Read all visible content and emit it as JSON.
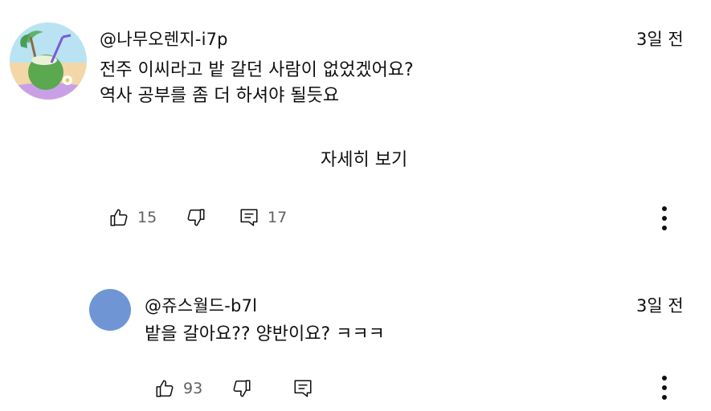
{
  "comment": {
    "author": "@나무오렌지-i7p",
    "time": "3일 전",
    "lines": [
      "전주 이씨라고 밭 갈던 사람이 없었겠어요?",
      "역사 공부를 좀 더 하셔야 될듯요"
    ],
    "read_more": "자세히 보기",
    "likes": "15",
    "replies": "17",
    "icons": {
      "like": "thumbs-up-icon",
      "dislike": "thumbs-down-icon",
      "reply": "reply-comment-icon",
      "more": "more-vertical-icon"
    }
  },
  "reply": {
    "author": "@쥬스월드-b7l",
    "time": "3일 전",
    "text": "밭을 갈아요?? 양반이요? ㅋㅋㅋ",
    "likes": "93",
    "avatar_color": "#6f95d4"
  },
  "colors": {
    "text": "#0f0f0f",
    "secondary": "#606060",
    "background": "#ffffff"
  }
}
